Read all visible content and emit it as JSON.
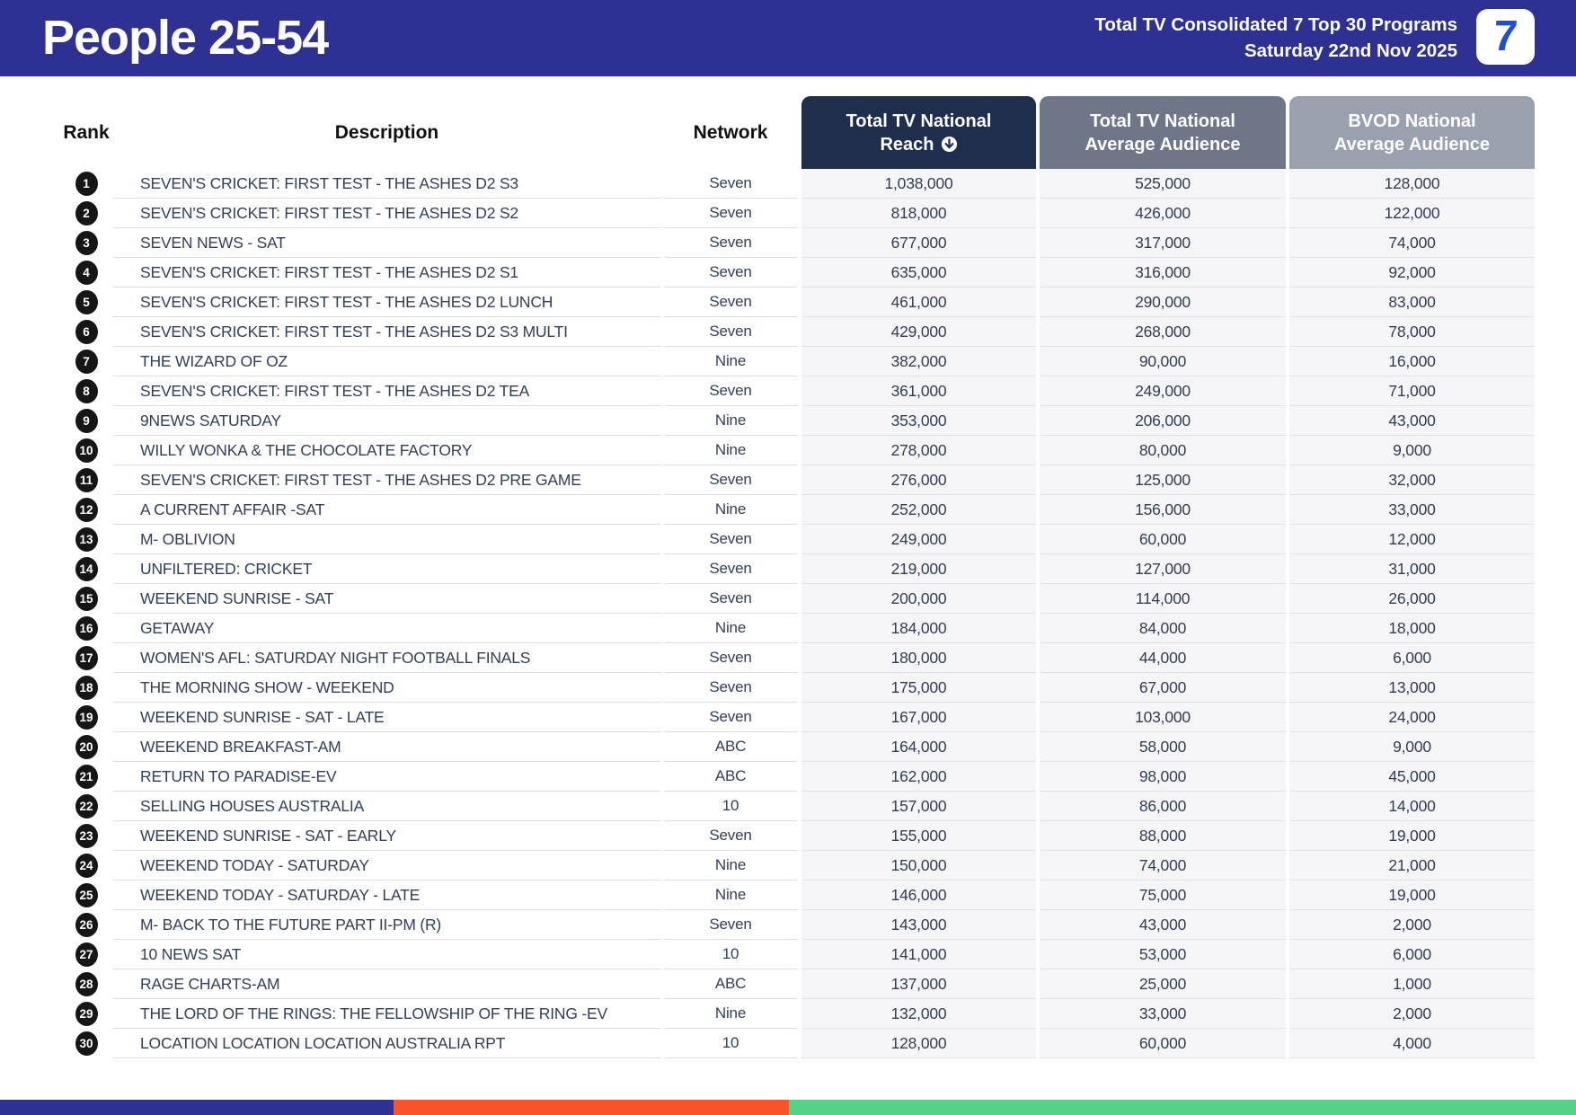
{
  "header": {
    "title": "People 25-54",
    "subtitle_line1": "Total TV Consolidated 7 Top 30 Programs",
    "subtitle_line2": "Saturday 22nd Nov 2025",
    "logo_text": "7"
  },
  "colors": {
    "header_blue": "#2E3192",
    "reach_header_bg": "#202E4E",
    "avg_header_bg": "#6E7787",
    "bvod_header_bg": "#9AA1AE",
    "footer_blue": "#2E3192",
    "footer_orange": "#F95327",
    "footer_green": "#54D287"
  },
  "table": {
    "columns": {
      "rank": "Rank",
      "description": "Description",
      "network": "Network",
      "reach_line1": "Total TV National",
      "reach_line2": "Reach",
      "reach_sort_icon": "circled-down-arrow",
      "avg_line1": "Total TV National",
      "avg_line2": "Average Audience",
      "bvod_line1": "BVOD National",
      "bvod_line2": "Average Audience"
    },
    "rows": [
      {
        "rank": "1",
        "description": "SEVEN'S CRICKET: FIRST TEST - THE ASHES D2 S3",
        "network": "Seven",
        "reach": "1,038,000",
        "avg_audience": "525,000",
        "bvod": "128,000"
      },
      {
        "rank": "2",
        "description": "SEVEN'S CRICKET: FIRST TEST - THE ASHES D2 S2",
        "network": "Seven",
        "reach": "818,000",
        "avg_audience": "426,000",
        "bvod": "122,000"
      },
      {
        "rank": "3",
        "description": "SEVEN NEWS - SAT",
        "network": "Seven",
        "reach": "677,000",
        "avg_audience": "317,000",
        "bvod": "74,000"
      },
      {
        "rank": "4",
        "description": "SEVEN'S CRICKET: FIRST TEST - THE ASHES D2 S1",
        "network": "Seven",
        "reach": "635,000",
        "avg_audience": "316,000",
        "bvod": "92,000"
      },
      {
        "rank": "5",
        "description": "SEVEN'S CRICKET: FIRST TEST - THE ASHES D2 LUNCH",
        "network": "Seven",
        "reach": "461,000",
        "avg_audience": "290,000",
        "bvod": "83,000"
      },
      {
        "rank": "6",
        "description": "SEVEN'S CRICKET: FIRST TEST - THE ASHES D2 S3 MULTI",
        "network": "Seven",
        "reach": "429,000",
        "avg_audience": "268,000",
        "bvod": "78,000"
      },
      {
        "rank": "7",
        "description": "THE WIZARD OF OZ",
        "network": "Nine",
        "reach": "382,000",
        "avg_audience": "90,000",
        "bvod": "16,000"
      },
      {
        "rank": "8",
        "description": "SEVEN'S CRICKET: FIRST TEST - THE ASHES D2 TEA",
        "network": "Seven",
        "reach": "361,000",
        "avg_audience": "249,000",
        "bvod": "71,000"
      },
      {
        "rank": "9",
        "description": "9NEWS SATURDAY",
        "network": "Nine",
        "reach": "353,000",
        "avg_audience": "206,000",
        "bvod": "43,000"
      },
      {
        "rank": "10",
        "description": "WILLY WONKA & THE CHOCOLATE FACTORY",
        "network": "Nine",
        "reach": "278,000",
        "avg_audience": "80,000",
        "bvod": "9,000"
      },
      {
        "rank": "11",
        "description": "SEVEN'S CRICKET: FIRST TEST - THE ASHES D2 PRE GAME",
        "network": "Seven",
        "reach": "276,000",
        "avg_audience": "125,000",
        "bvod": "32,000"
      },
      {
        "rank": "12",
        "description": "A CURRENT AFFAIR -SAT",
        "network": "Nine",
        "reach": "252,000",
        "avg_audience": "156,000",
        "bvod": "33,000"
      },
      {
        "rank": "13",
        "description": "M- OBLIVION",
        "network": "Seven",
        "reach": "249,000",
        "avg_audience": "60,000",
        "bvod": "12,000"
      },
      {
        "rank": "14",
        "description": "UNFILTERED: CRICKET",
        "network": "Seven",
        "reach": "219,000",
        "avg_audience": "127,000",
        "bvod": "31,000"
      },
      {
        "rank": "15",
        "description": "WEEKEND SUNRISE - SAT",
        "network": "Seven",
        "reach": "200,000",
        "avg_audience": "114,000",
        "bvod": "26,000"
      },
      {
        "rank": "16",
        "description": "GETAWAY",
        "network": "Nine",
        "reach": "184,000",
        "avg_audience": "84,000",
        "bvod": "18,000"
      },
      {
        "rank": "17",
        "description": "WOMEN'S AFL: SATURDAY NIGHT FOOTBALL FINALS",
        "network": "Seven",
        "reach": "180,000",
        "avg_audience": "44,000",
        "bvod": "6,000"
      },
      {
        "rank": "18",
        "description": "THE MORNING SHOW - WEEKEND",
        "network": "Seven",
        "reach": "175,000",
        "avg_audience": "67,000",
        "bvod": "13,000"
      },
      {
        "rank": "19",
        "description": "WEEKEND SUNRISE - SAT - LATE",
        "network": "Seven",
        "reach": "167,000",
        "avg_audience": "103,000",
        "bvod": "24,000"
      },
      {
        "rank": "20",
        "description": "WEEKEND BREAKFAST-AM",
        "network": "ABC",
        "reach": "164,000",
        "avg_audience": "58,000",
        "bvod": "9,000"
      },
      {
        "rank": "21",
        "description": "RETURN TO PARADISE-EV",
        "network": "ABC",
        "reach": "162,000",
        "avg_audience": "98,000",
        "bvod": "45,000"
      },
      {
        "rank": "22",
        "description": "SELLING HOUSES AUSTRALIA",
        "network": "10",
        "reach": "157,000",
        "avg_audience": "86,000",
        "bvod": "14,000"
      },
      {
        "rank": "23",
        "description": "WEEKEND SUNRISE - SAT - EARLY",
        "network": "Seven",
        "reach": "155,000",
        "avg_audience": "88,000",
        "bvod": "19,000"
      },
      {
        "rank": "24",
        "description": "WEEKEND TODAY - SATURDAY",
        "network": "Nine",
        "reach": "150,000",
        "avg_audience": "74,000",
        "bvod": "21,000"
      },
      {
        "rank": "25",
        "description": "WEEKEND TODAY - SATURDAY - LATE",
        "network": "Nine",
        "reach": "146,000",
        "avg_audience": "75,000",
        "bvod": "19,000"
      },
      {
        "rank": "26",
        "description": "M- BACK TO THE FUTURE PART II-PM (R)",
        "network": "Seven",
        "reach": "143,000",
        "avg_audience": "43,000",
        "bvod": "2,000"
      },
      {
        "rank": "27",
        "description": "10 NEWS SAT",
        "network": "10",
        "reach": "141,000",
        "avg_audience": "53,000",
        "bvod": "6,000"
      },
      {
        "rank": "28",
        "description": "RAGE CHARTS-AM",
        "network": "ABC",
        "reach": "137,000",
        "avg_audience": "25,000",
        "bvod": "1,000"
      },
      {
        "rank": "29",
        "description": "THE LORD OF THE RINGS: THE FELLOWSHIP OF THE RING -EV",
        "network": "Nine",
        "reach": "132,000",
        "avg_audience": "33,000",
        "bvod": "2,000"
      },
      {
        "rank": "30",
        "description": "LOCATION LOCATION LOCATION AUSTRALIA RPT",
        "network": "10",
        "reach": "128,000",
        "avg_audience": "60,000",
        "bvod": "4,000"
      }
    ]
  }
}
